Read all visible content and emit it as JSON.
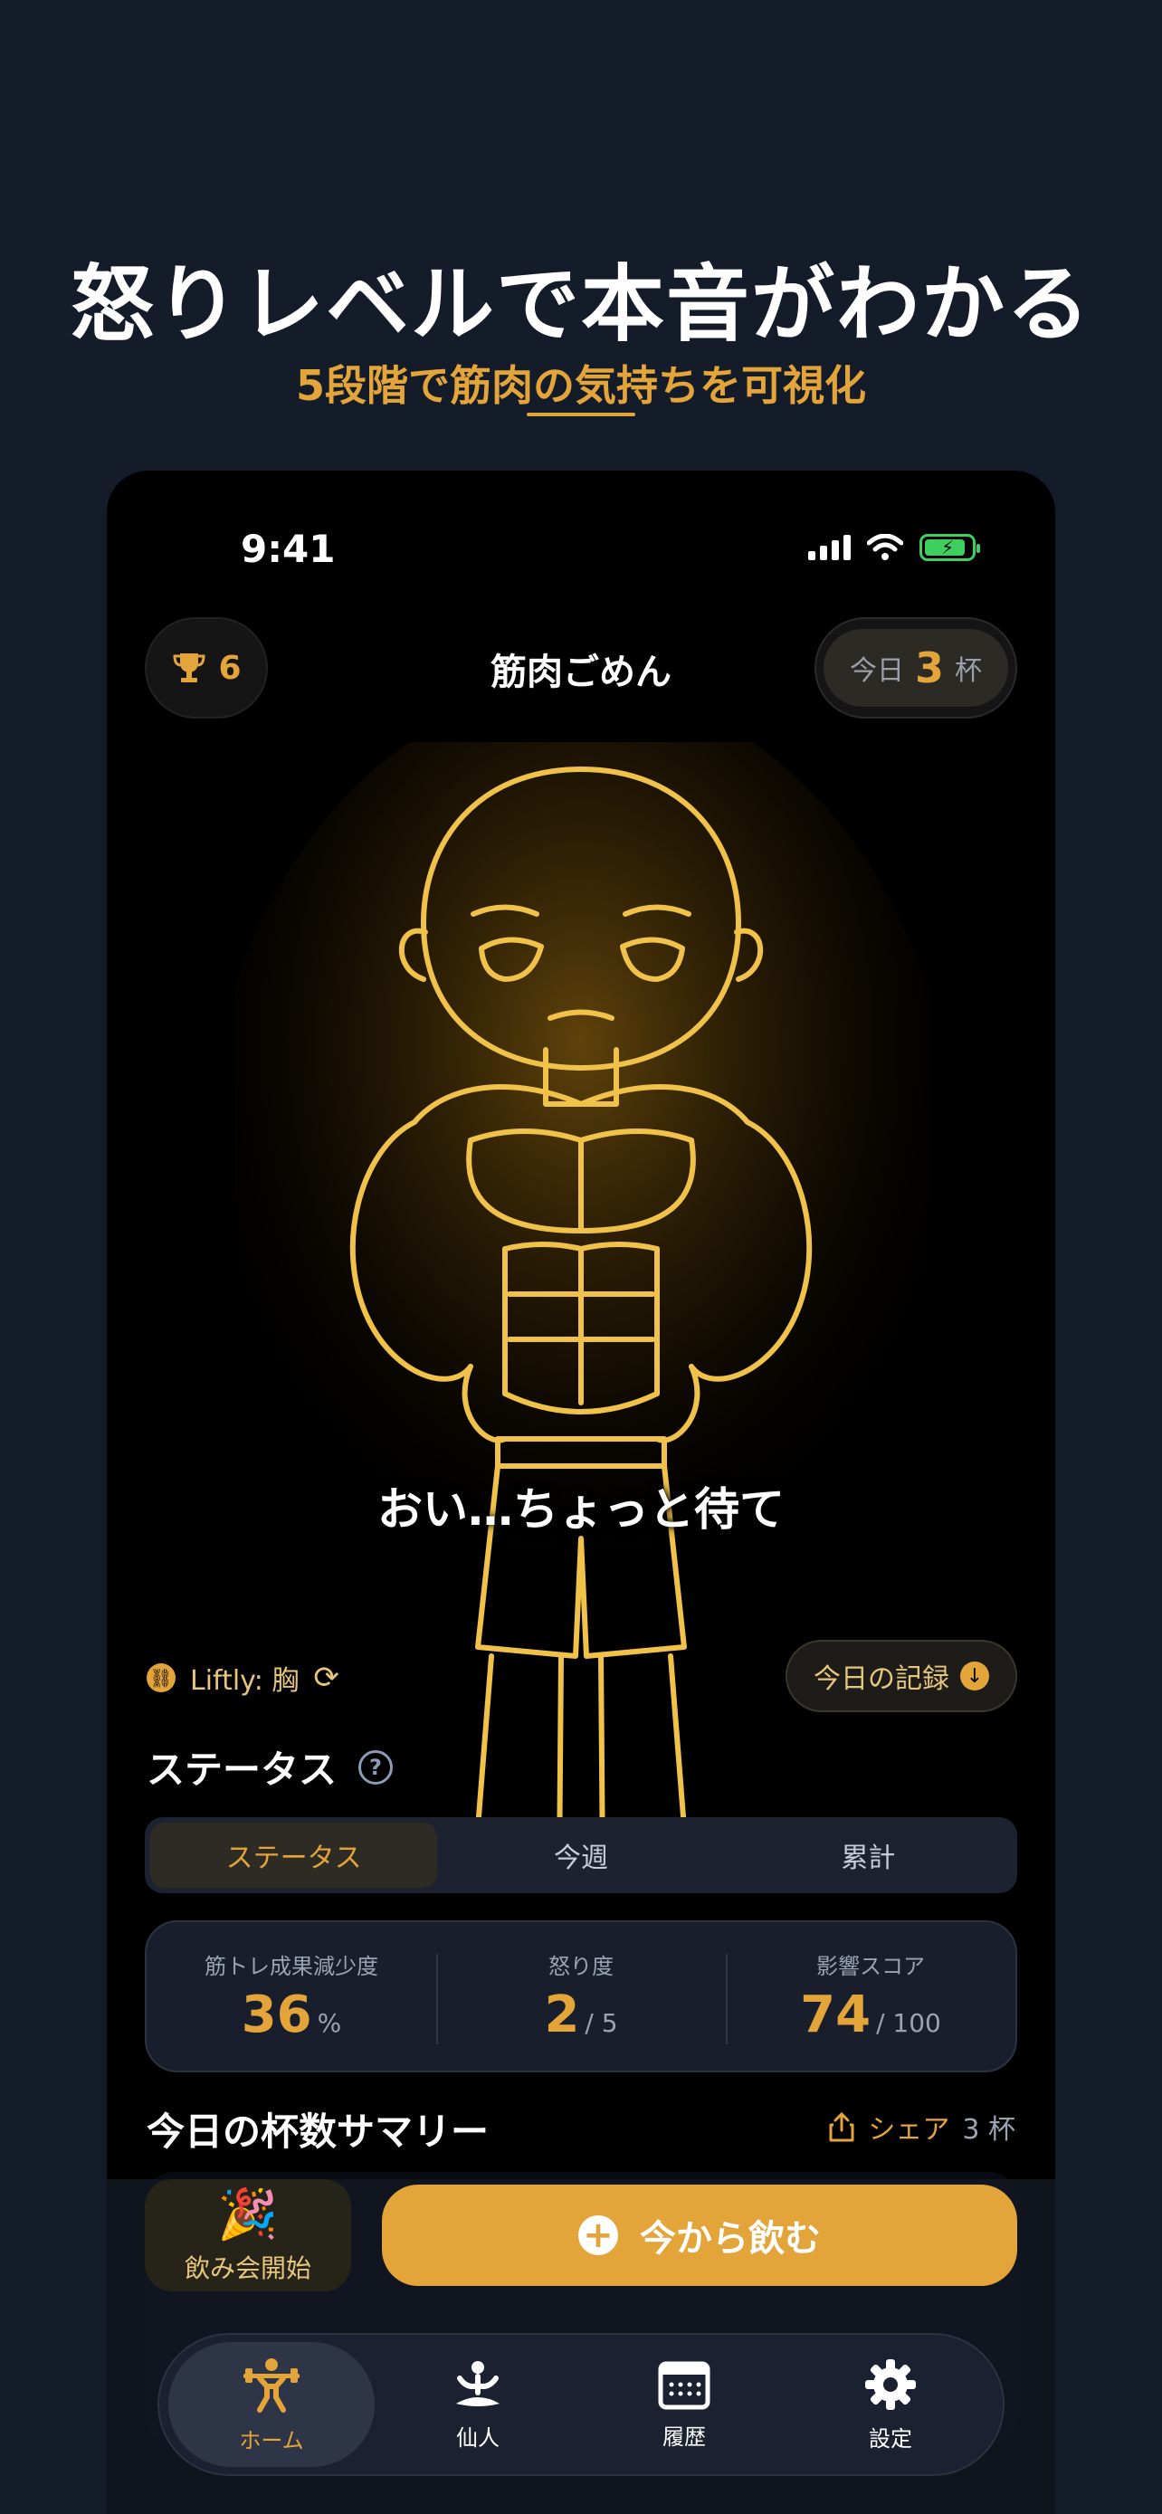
{
  "promo": {
    "headline": "怒りレベルで本音がわかる",
    "subline": "5段階で筋肉の気持ちを可視化"
  },
  "status_bar": {
    "time": "9:41"
  },
  "header": {
    "trophy_count": "6",
    "app_title": "筋肉ごめん",
    "today_label": "今日",
    "today_count": "3",
    "today_unit": "杯"
  },
  "mascot": {
    "speech": "おい…ちょっと待て"
  },
  "liftly": {
    "label": "Liftly: 胸"
  },
  "record_button": "今日の記録",
  "status_section": {
    "title": "ステータス",
    "tabs": [
      "ステータス",
      "今週",
      "累計"
    ],
    "active_tab": 0
  },
  "stats": [
    {
      "label": "筋トレ成果減少度",
      "value": "36",
      "unit": "%"
    },
    {
      "label": "怒り度",
      "value": "2",
      "unit": "/ 5"
    },
    {
      "label": "影響スコア",
      "value": "74",
      "unit": "/ 100"
    }
  ],
  "summary": {
    "title": "今日の杯数サマリー",
    "share_label": "シェア",
    "count": "3 杯"
  },
  "actions": {
    "party_label": "飲み会開始",
    "drink_label": "今から飲む"
  },
  "tabbar": [
    {
      "label": "ホーム",
      "icon": "weightlifter-icon",
      "active": true
    },
    {
      "label": "仙人",
      "icon": "meditation-icon",
      "active": false
    },
    {
      "label": "履歴",
      "icon": "calendar-icon",
      "active": false
    },
    {
      "label": "設定",
      "icon": "gear-icon",
      "active": false
    }
  ],
  "colors": {
    "accent": "#e3a43a",
    "background": "#141b29",
    "phone_bg": "#000000",
    "battery": "#3fcf5e"
  }
}
